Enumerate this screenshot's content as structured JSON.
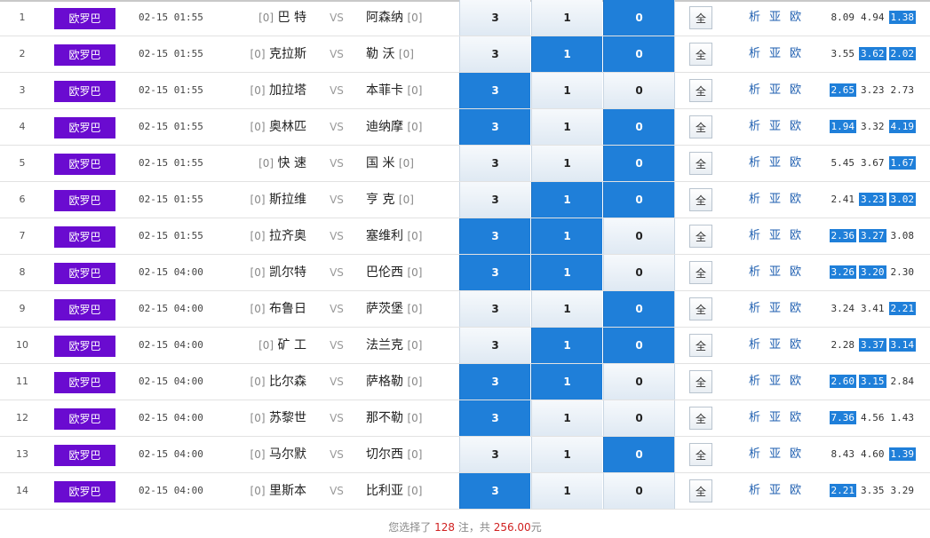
{
  "rows": [
    {
      "num": "1",
      "league": "欧罗巴",
      "time": "02-15 01:55",
      "home_rank": "[0]",
      "home": "巴 特",
      "vs": "VS",
      "away": "阿森纳",
      "away_rank": "[0]",
      "opt3": "3",
      "opt1": "1",
      "opt0": "0",
      "sel": [
        false,
        false,
        true
      ],
      "all": "全",
      "links": [
        "析",
        "亚",
        "欧"
      ],
      "odds": [
        "8.09",
        "4.94",
        "1.38"
      ],
      "hl": [
        false,
        false,
        true
      ]
    },
    {
      "num": "2",
      "league": "欧罗巴",
      "time": "02-15 01:55",
      "home_rank": "[0]",
      "home": "克拉斯",
      "vs": "VS",
      "away": "勒 沃",
      "away_rank": "[0]",
      "opt3": "3",
      "opt1": "1",
      "opt0": "0",
      "sel": [
        false,
        true,
        true
      ],
      "all": "全",
      "links": [
        "析",
        "亚",
        "欧"
      ],
      "odds": [
        "3.55",
        "3.62",
        "2.02"
      ],
      "hl": [
        false,
        true,
        true
      ]
    },
    {
      "num": "3",
      "league": "欧罗巴",
      "time": "02-15 01:55",
      "home_rank": "[0]",
      "home": "加拉塔",
      "vs": "VS",
      "away": "本菲卡",
      "away_rank": "[0]",
      "opt3": "3",
      "opt1": "1",
      "opt0": "0",
      "sel": [
        true,
        false,
        false
      ],
      "all": "全",
      "links": [
        "析",
        "亚",
        "欧"
      ],
      "odds": [
        "2.65",
        "3.23",
        "2.73"
      ],
      "hl": [
        true,
        false,
        false
      ]
    },
    {
      "num": "4",
      "league": "欧罗巴",
      "time": "02-15 01:55",
      "home_rank": "[0]",
      "home": "奥林匹",
      "vs": "VS",
      "away": "迪纳摩",
      "away_rank": "[0]",
      "opt3": "3",
      "opt1": "1",
      "opt0": "0",
      "sel": [
        true,
        false,
        true
      ],
      "all": "全",
      "links": [
        "析",
        "亚",
        "欧"
      ],
      "odds": [
        "1.94",
        "3.32",
        "4.19"
      ],
      "hl": [
        true,
        false,
        true
      ]
    },
    {
      "num": "5",
      "league": "欧罗巴",
      "time": "02-15 01:55",
      "home_rank": "[0]",
      "home": "快 速",
      "vs": "VS",
      "away": "国 米",
      "away_rank": "[0]",
      "opt3": "3",
      "opt1": "1",
      "opt0": "0",
      "sel": [
        false,
        false,
        true
      ],
      "all": "全",
      "links": [
        "析",
        "亚",
        "欧"
      ],
      "odds": [
        "5.45",
        "3.67",
        "1.67"
      ],
      "hl": [
        false,
        false,
        true
      ]
    },
    {
      "num": "6",
      "league": "欧罗巴",
      "time": "02-15 01:55",
      "home_rank": "[0]",
      "home": "斯拉维",
      "vs": "VS",
      "away": "亨 克",
      "away_rank": "[0]",
      "opt3": "3",
      "opt1": "1",
      "opt0": "0",
      "sel": [
        false,
        true,
        true
      ],
      "all": "全",
      "links": [
        "析",
        "亚",
        "欧"
      ],
      "odds": [
        "2.41",
        "3.23",
        "3.02"
      ],
      "hl": [
        false,
        true,
        true
      ]
    },
    {
      "num": "7",
      "league": "欧罗巴",
      "time": "02-15 01:55",
      "home_rank": "[0]",
      "home": "拉齐奥",
      "vs": "VS",
      "away": "塞维利",
      "away_rank": "[0]",
      "opt3": "3",
      "opt1": "1",
      "opt0": "0",
      "sel": [
        true,
        true,
        false
      ],
      "all": "全",
      "links": [
        "析",
        "亚",
        "欧"
      ],
      "odds": [
        "2.36",
        "3.27",
        "3.08"
      ],
      "hl": [
        true,
        true,
        false
      ]
    },
    {
      "num": "8",
      "league": "欧罗巴",
      "time": "02-15 04:00",
      "home_rank": "[0]",
      "home": "凯尔特",
      "vs": "VS",
      "away": "巴伦西",
      "away_rank": "[0]",
      "opt3": "3",
      "opt1": "1",
      "opt0": "0",
      "sel": [
        true,
        true,
        false
      ],
      "all": "全",
      "links": [
        "析",
        "亚",
        "欧"
      ],
      "odds": [
        "3.26",
        "3.20",
        "2.30"
      ],
      "hl": [
        true,
        true,
        false
      ]
    },
    {
      "num": "9",
      "league": "欧罗巴",
      "time": "02-15 04:00",
      "home_rank": "[0]",
      "home": "布鲁日",
      "vs": "VS",
      "away": "萨茨堡",
      "away_rank": "[0]",
      "opt3": "3",
      "opt1": "1",
      "opt0": "0",
      "sel": [
        false,
        false,
        true
      ],
      "all": "全",
      "links": [
        "析",
        "亚",
        "欧"
      ],
      "odds": [
        "3.24",
        "3.41",
        "2.21"
      ],
      "hl": [
        false,
        false,
        true
      ]
    },
    {
      "num": "10",
      "league": "欧罗巴",
      "time": "02-15 04:00",
      "home_rank": "[0]",
      "home": "矿 工",
      "vs": "VS",
      "away": "法兰克",
      "away_rank": "[0]",
      "opt3": "3",
      "opt1": "1",
      "opt0": "0",
      "sel": [
        false,
        true,
        true
      ],
      "all": "全",
      "links": [
        "析",
        "亚",
        "欧"
      ],
      "odds": [
        "2.28",
        "3.37",
        "3.14"
      ],
      "hl": [
        false,
        true,
        true
      ]
    },
    {
      "num": "11",
      "league": "欧罗巴",
      "time": "02-15 04:00",
      "home_rank": "[0]",
      "home": "比尔森",
      "vs": "VS",
      "away": "萨格勒",
      "away_rank": "[0]",
      "opt3": "3",
      "opt1": "1",
      "opt0": "0",
      "sel": [
        true,
        true,
        false
      ],
      "all": "全",
      "links": [
        "析",
        "亚",
        "欧"
      ],
      "odds": [
        "2.60",
        "3.15",
        "2.84"
      ],
      "hl": [
        true,
        true,
        false
      ]
    },
    {
      "num": "12",
      "league": "欧罗巴",
      "time": "02-15 04:00",
      "home_rank": "[0]",
      "home": "苏黎世",
      "vs": "VS",
      "away": "那不勒",
      "away_rank": "[0]",
      "opt3": "3",
      "opt1": "1",
      "opt0": "0",
      "sel": [
        true,
        false,
        false
      ],
      "all": "全",
      "links": [
        "析",
        "亚",
        "欧"
      ],
      "odds": [
        "7.36",
        "4.56",
        "1.43"
      ],
      "hl": [
        true,
        false,
        false
      ]
    },
    {
      "num": "13",
      "league": "欧罗巴",
      "time": "02-15 04:00",
      "home_rank": "[0]",
      "home": "马尔默",
      "vs": "VS",
      "away": "切尔西",
      "away_rank": "[0]",
      "opt3": "3",
      "opt1": "1",
      "opt0": "0",
      "sel": [
        false,
        false,
        true
      ],
      "all": "全",
      "links": [
        "析",
        "亚",
        "欧"
      ],
      "odds": [
        "8.43",
        "4.60",
        "1.39"
      ],
      "hl": [
        false,
        false,
        true
      ]
    },
    {
      "num": "14",
      "league": "欧罗巴",
      "time": "02-15 04:00",
      "home_rank": "[0]",
      "home": "里斯本",
      "vs": "VS",
      "away": "比利亚",
      "away_rank": "[0]",
      "opt3": "3",
      "opt1": "1",
      "opt0": "0",
      "sel": [
        true,
        false,
        false
      ],
      "all": "全",
      "links": [
        "析",
        "亚",
        "欧"
      ],
      "odds": [
        "2.21",
        "3.35",
        "3.29"
      ],
      "hl": [
        true,
        false,
        false
      ]
    }
  ],
  "footer": {
    "prefix": "您选择了",
    "bets": "128",
    "mid": "注，共",
    "amount": "256.00",
    "suffix": "元"
  },
  "colors": {
    "league_bg": "#6a0bd0",
    "selected": "#1f7fd9",
    "link": "#1f5fb0",
    "accent_red": "#d02020"
  }
}
